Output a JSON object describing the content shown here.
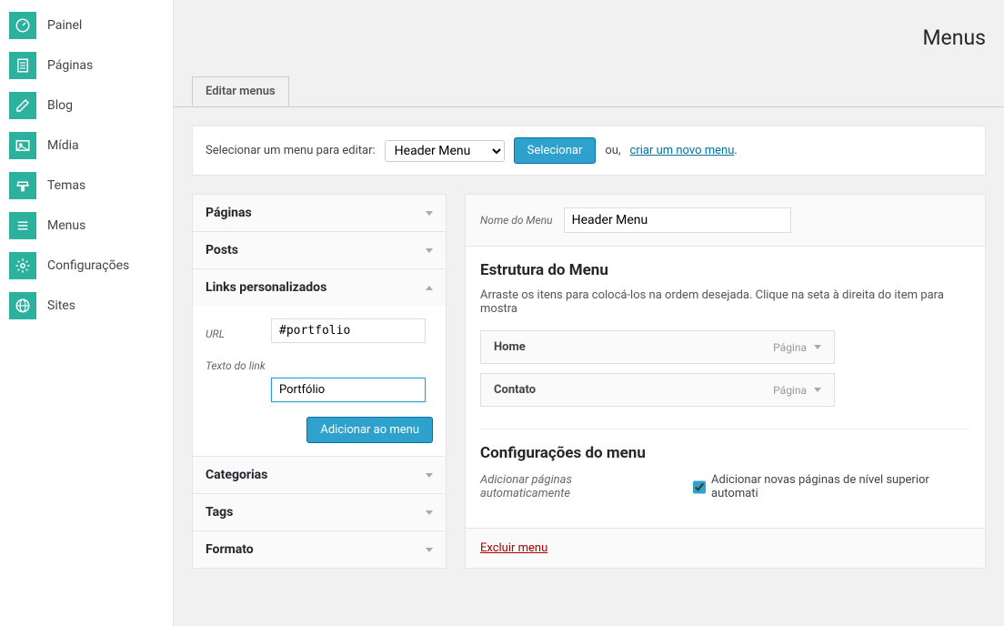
{
  "sidebar": {
    "items": [
      {
        "label": "Painel"
      },
      {
        "label": "Páginas"
      },
      {
        "label": "Blog"
      },
      {
        "label": "Mídia"
      },
      {
        "label": "Temas"
      },
      {
        "label": "Menus"
      },
      {
        "label": "Configurações"
      },
      {
        "label": "Sites"
      }
    ]
  },
  "page": {
    "title": "Menus"
  },
  "tabs": {
    "edit": "Editar menus"
  },
  "selectbar": {
    "label": "Selecionar um menu para editar:",
    "selected": "Header Menu",
    "button": "Selecionar",
    "or": "ou,",
    "create_link": "criar um novo menu",
    "period": "."
  },
  "accordion": {
    "paginas": "Páginas",
    "posts": "Posts",
    "links": "Links personalizados",
    "links_body": {
      "url_label": "URL",
      "url_value": "#portfolio",
      "text_label": "Texto do link",
      "text_value": "Portfólio",
      "button": "Adicionar ao menu"
    },
    "categorias": "Categorias",
    "tags": "Tags",
    "formato": "Formato"
  },
  "rightpanel": {
    "name_label": "Nome do Menu",
    "name_value": "Header Menu",
    "structure_title": "Estrutura do Menu",
    "structure_desc": "Arraste os itens para colocá-los na ordem desejada. Clique na seta à direita do item para mostra",
    "items": [
      {
        "title": "Home",
        "type": "Página"
      },
      {
        "title": "Contato",
        "type": "Página"
      }
    ],
    "settings_title": "Configurações do menu",
    "auto_label": "Adicionar páginas automaticamente",
    "auto_cb": "Adicionar novas páginas de nível superior automati",
    "delete": "Excluir menu"
  }
}
